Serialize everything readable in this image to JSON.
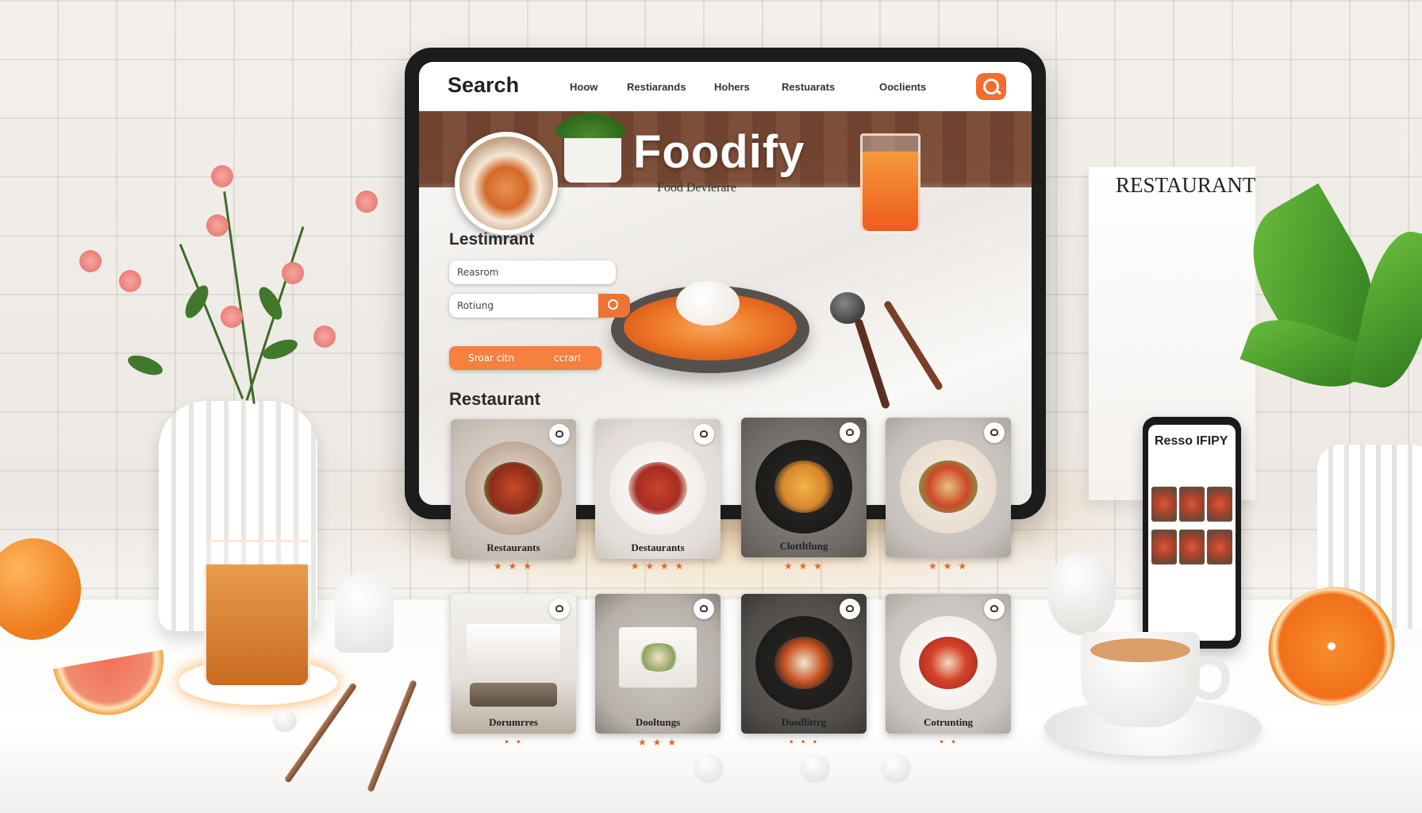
{
  "app": {
    "nav": {
      "search_label": "Search",
      "links": [
        "Hoow",
        "Restiarands",
        "Hohers",
        "Restuarats",
        "Ooclients"
      ],
      "search_button_icon": "search-icon"
    },
    "hero": {
      "brand": "Foodify",
      "tagline": "Food Devlerare"
    },
    "search_panel": {
      "title": "Lestimrant",
      "field1_placeholder": "Reasrom",
      "field2_placeholder": "Rotiung",
      "cta_left": "Sroar citn",
      "cta_right": "ccrarl"
    },
    "restaurants": {
      "title": "Restaurant",
      "row1": [
        {
          "label": "Restaurants",
          "stars": "★ ★ ★"
        },
        {
          "label": "Destaurants",
          "stars": "★ ★ ★ ★"
        },
        {
          "label": "Clottltlung",
          "stars": "★ ★ ★"
        },
        {
          "label": "",
          "stars": "★ ★ ★"
        }
      ],
      "row2": [
        {
          "label": "Dorumrres",
          "stars": "• •"
        },
        {
          "label": "Dooltungs",
          "stars": "★ ★ ★"
        },
        {
          "label": "Dosdlittrg",
          "stars": "• • •"
        },
        {
          "label": "Cotrunting",
          "stars": "• •"
        }
      ]
    }
  },
  "decor": {
    "sign_text": "RESTAURANT",
    "phone_title": "Resso IFIPY"
  },
  "colors": {
    "accent": "#f36d2e",
    "hero_wood": "#7a4b36"
  }
}
